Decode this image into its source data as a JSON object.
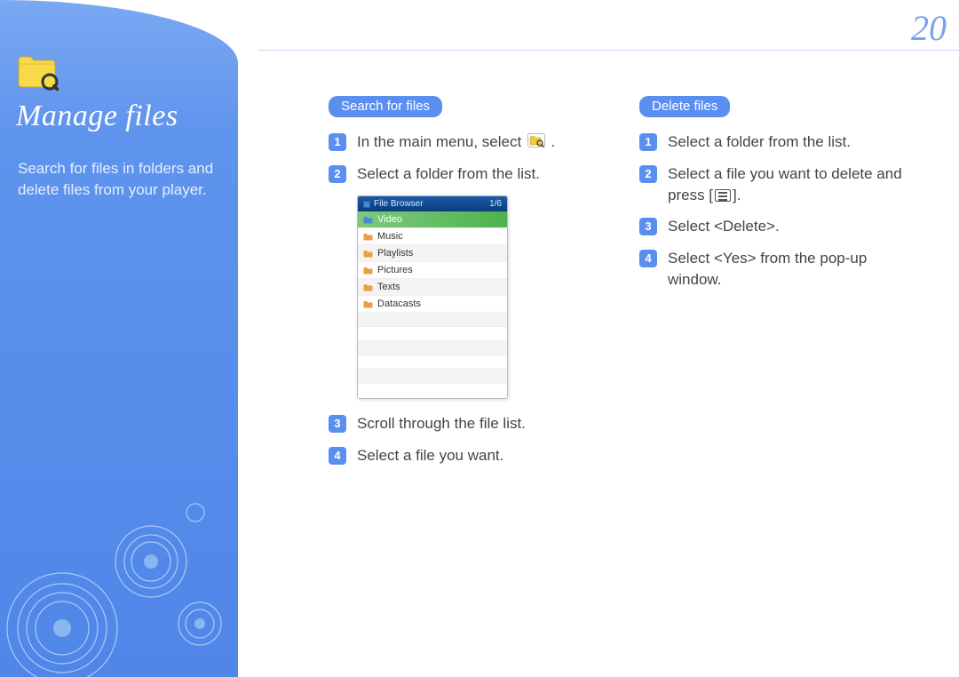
{
  "page_number": "20",
  "sidebar": {
    "title": "Manage files",
    "description": "Search for files in folders and delete files from your player."
  },
  "section_search": {
    "heading": "Search for files",
    "steps": {
      "s1_pre": "In the main menu, select ",
      "s1_post": ".",
      "s2": "Select a folder from the list.",
      "s3": "Scroll through the file list.",
      "s4": "Select a file you want."
    },
    "file_browser": {
      "title": "File Browser",
      "count": "1/6",
      "items": [
        "Video",
        "Music",
        "Playlists",
        "Pictures",
        "Texts",
        "Datacasts"
      ]
    }
  },
  "section_delete": {
    "heading": "Delete files",
    "steps": {
      "s1": "Select a folder from the list.",
      "s2_pre": "Select a file you want to delete and press [",
      "s2_post": "].",
      "s3": "Select <Delete>.",
      "s4": "Select <Yes> from the pop-up window."
    }
  }
}
